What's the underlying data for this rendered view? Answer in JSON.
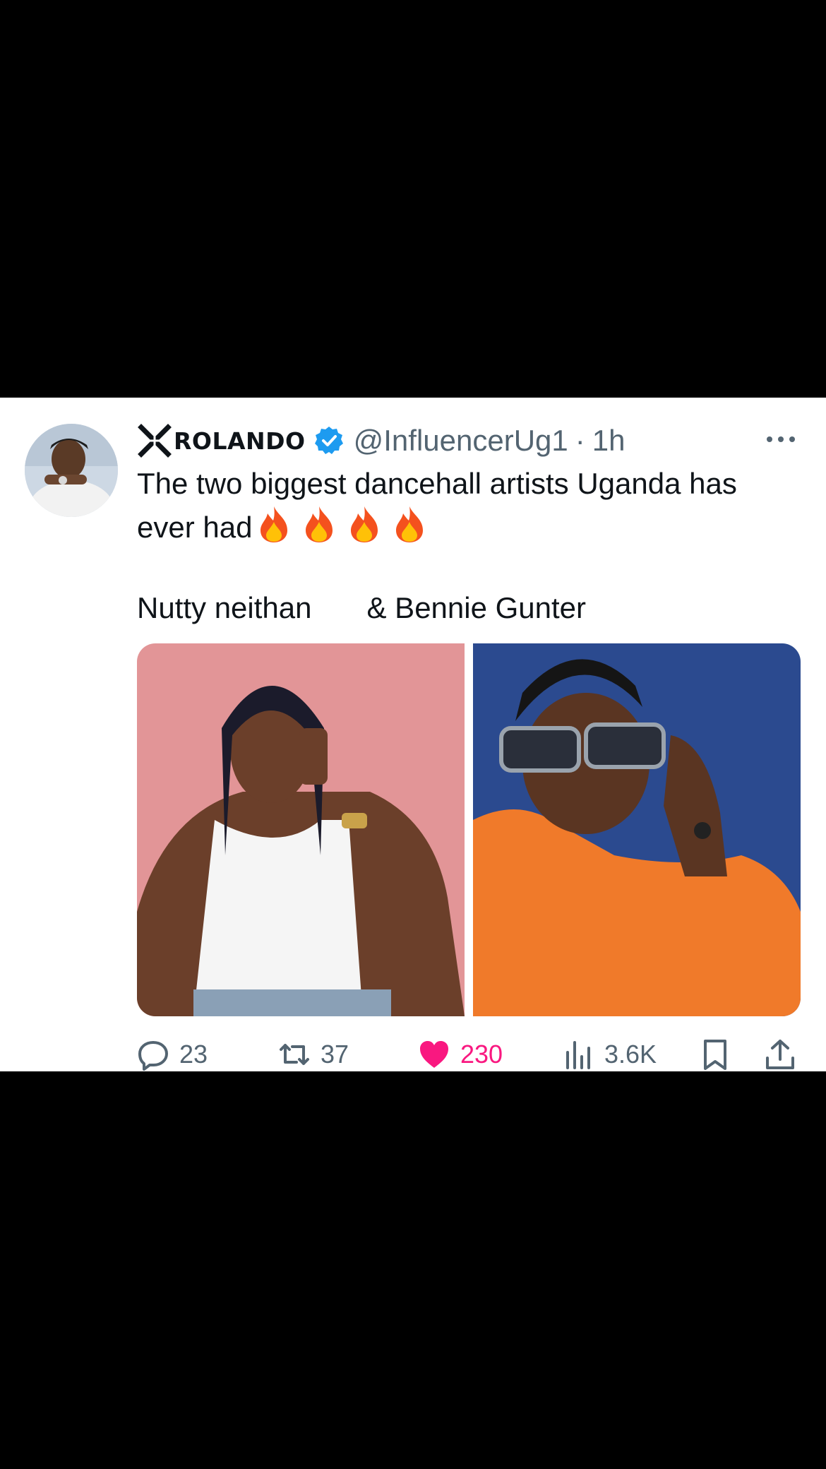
{
  "tweet": {
    "display_name": "ROLANDO",
    "handle": "@InfluencerUg1",
    "separator": "·",
    "time": "1h",
    "text_line1": "The two biggest dancehall artists Uganda has ever had",
    "artist_one": "Nutty neithan",
    "artist_two": "& Bennie Gunter",
    "flame_count": 4
  },
  "actions": {
    "replies": "23",
    "reposts": "37",
    "likes": "230",
    "views": "3.6K",
    "liked": true
  },
  "icons": {
    "brand": "crossed-x-icon",
    "verified": "verified-badge-icon",
    "more": "more-dots-icon",
    "reply": "reply-icon",
    "repost": "repost-icon",
    "like": "heart-icon",
    "views": "views-chart-icon",
    "bookmark": "bookmark-icon",
    "share": "share-icon"
  },
  "colors": {
    "text": "#0f1419",
    "muted": "#536471",
    "verified": "#1d9bf0",
    "like": "#f91880",
    "left_photo_bg": "#e29597",
    "right_photo_bg": "#2b4a8f",
    "jacket": "#f07a2a"
  }
}
